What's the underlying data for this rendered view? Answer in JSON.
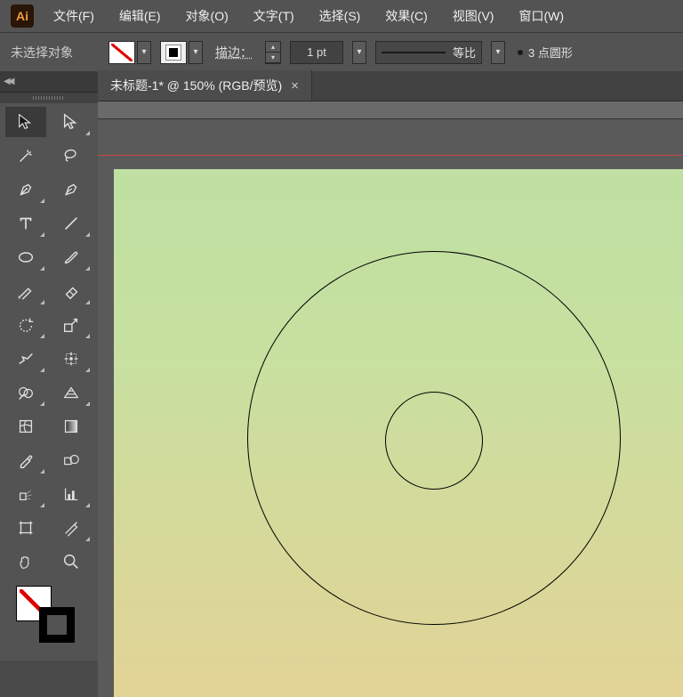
{
  "app": {
    "short_name": "Ai"
  },
  "menu": {
    "file": "文件(F)",
    "edit": "编辑(E)",
    "object": "对象(O)",
    "type": "文字(T)",
    "select": "选择(S)",
    "effect": "效果(C)",
    "view": "视图(V)",
    "window": "窗口(W)"
  },
  "controlbar": {
    "selection_status": "未选择对象",
    "stroke_label": "描边：",
    "stroke_value": "1 pt",
    "profile_label": "等比",
    "brush_label": "3 点圆形"
  },
  "tab": {
    "title": "未标题-1* @ 150% (RGB/预览)",
    "close": "×"
  },
  "panel_strip": {
    "arrows": "◀◀"
  },
  "tools": {
    "selection": "selection-tool",
    "direct_selection": "direct-selection-tool",
    "magic_wand": "magic-wand-tool",
    "lasso": "lasso-tool",
    "pen": "pen-tool",
    "curvature": "curvature-tool",
    "type": "type-tool",
    "line": "line-segment-tool",
    "ellipse": "ellipse-tool",
    "paintbrush": "paintbrush-tool",
    "shaper": "shaper-tool",
    "eraser": "eraser-tool",
    "rotate": "rotate-tool",
    "scale": "scale-tool",
    "width": "width-tool",
    "free_transform": "free-transform-tool",
    "shape_builder": "shape-builder-tool",
    "perspective": "perspective-grid-tool",
    "mesh": "mesh-tool",
    "gradient": "gradient-tool",
    "eyedropper": "eyedropper-tool",
    "blend": "blend-tool",
    "symbol_sprayer": "symbol-sprayer-tool",
    "column_graph": "column-graph-tool",
    "artboard": "artboard-tool",
    "slice": "slice-tool",
    "hand": "hand-tool",
    "zoom": "zoom-tool"
  }
}
